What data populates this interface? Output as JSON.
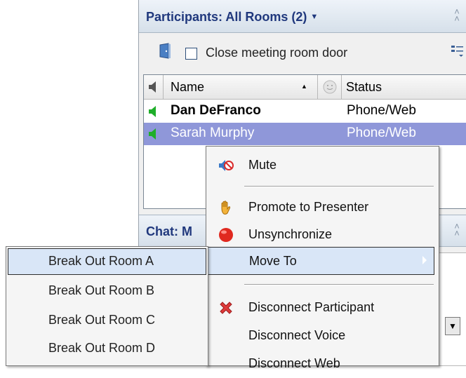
{
  "participants_pod": {
    "title": "Participants: All Rooms (2)",
    "title_dropdown_icon": "dropdown-arrow-icon",
    "collapse_icon": "collapse-chevron-icon",
    "door_checkbox_label": "Close meeting room door",
    "columns": {
      "speaker": "speaker-icon",
      "name": "Name",
      "name_sort": "sort-ascending-icon",
      "status_icon": "smiley-icon",
      "status": "Status"
    },
    "rows": [
      {
        "name": "Dan DeFranco",
        "status": "Phone/Web",
        "bold": true,
        "selected": false
      },
      {
        "name": "Sarah Murphy",
        "status": "Phone/Web",
        "bold": false,
        "selected": true
      }
    ]
  },
  "chat_pod": {
    "title": "Chat: M"
  },
  "context_menu": {
    "items": [
      {
        "label": "Mute",
        "icon": "mute-speaker-icon"
      },
      {
        "label": "Promote to Presenter",
        "icon": "raised-hand-icon"
      },
      {
        "label": "Unsynchronize",
        "icon": "red-circle-icon"
      },
      {
        "label": "Move To",
        "icon": "submenu-arrow-icon"
      },
      {
        "label": "Disconnect Participant",
        "icon": "red-x-icon"
      },
      {
        "label": "Disconnect Voice",
        "icon": ""
      },
      {
        "label": "Disconnect Web",
        "icon": ""
      }
    ]
  },
  "submenu": {
    "items": [
      {
        "label": "Break Out Room A"
      },
      {
        "label": "Break Out Room B"
      },
      {
        "label": "Break Out Room C"
      },
      {
        "label": "Break Out Room D"
      }
    ]
  },
  "colors": {
    "pod_title": "#20387d",
    "selection": "#8f97d9",
    "menu_hover": "#d9e6f7"
  }
}
